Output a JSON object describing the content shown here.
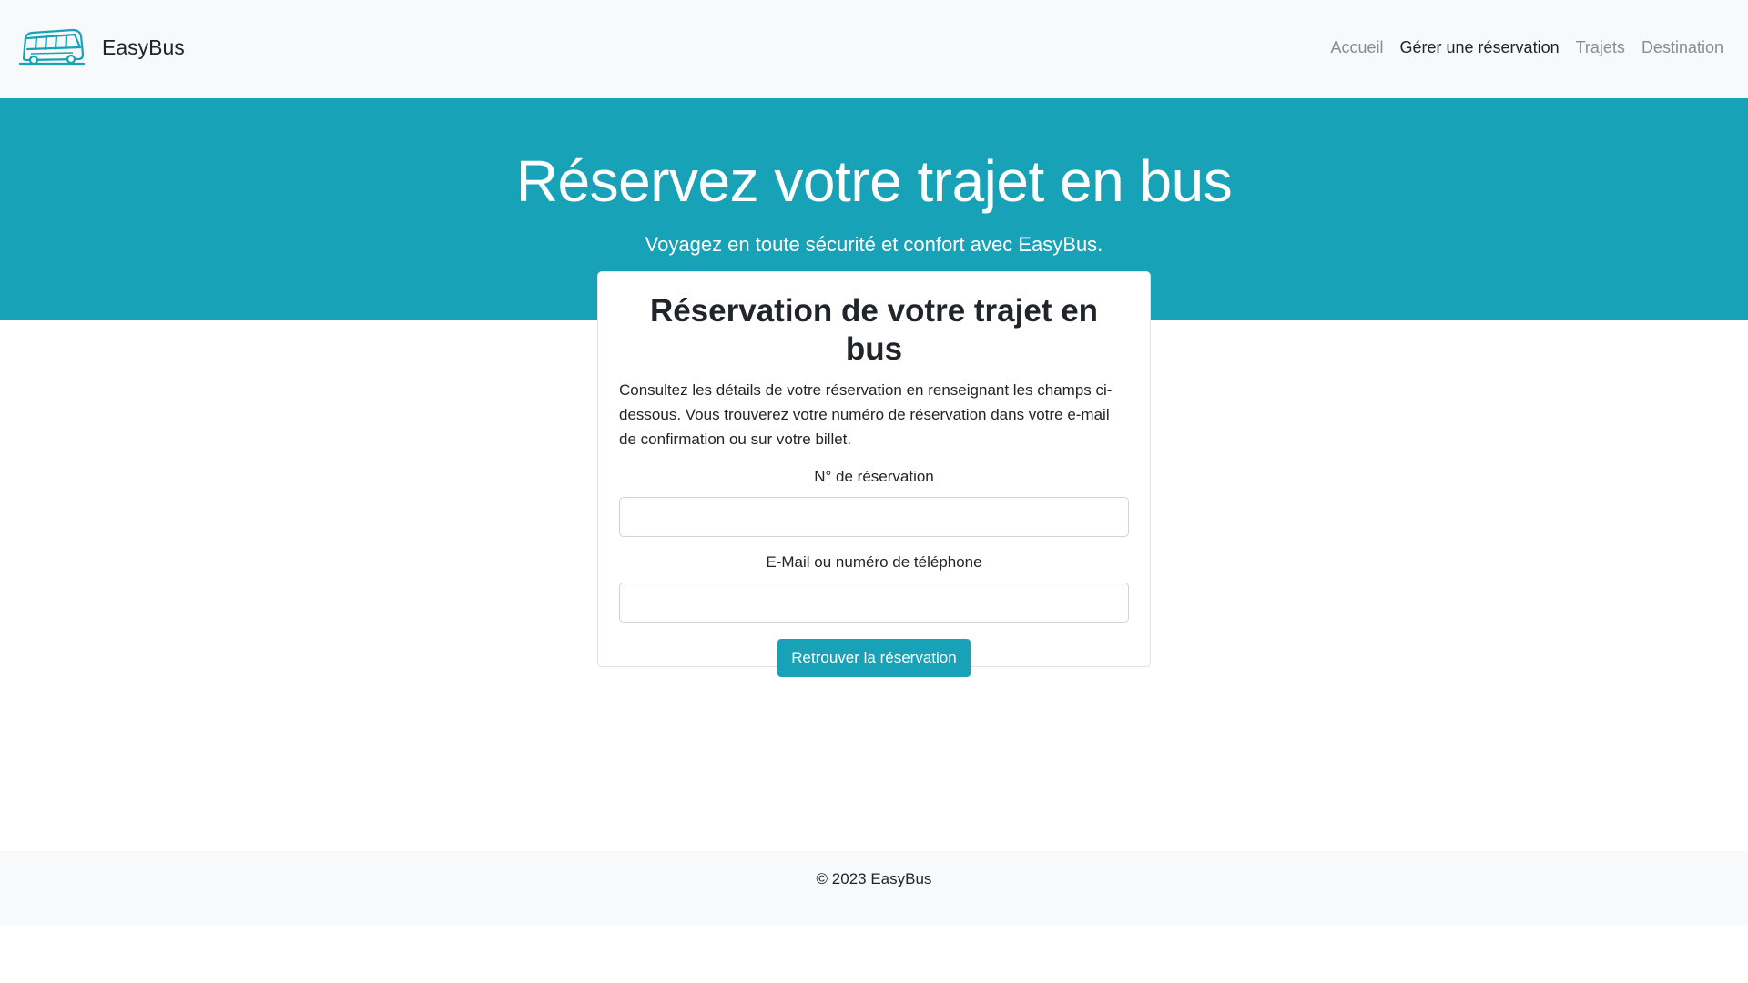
{
  "brand": {
    "name": "EasyBus",
    "logo_icon": "bus-icon",
    "accent_color": "#17a2b8"
  },
  "nav": {
    "items": [
      {
        "label": "Accueil",
        "active": false
      },
      {
        "label": "Gérer une réservation",
        "active": true
      },
      {
        "label": "Trajets",
        "active": false
      },
      {
        "label": "Destination",
        "active": false
      }
    ]
  },
  "hero": {
    "title": "Réservez votre trajet en bus",
    "subtitle": "Voyagez en toute sécurité et confort avec EasyBus."
  },
  "form": {
    "title": "Réservation de votre trajet en bus",
    "description": "Consultez les détails de votre réservation en renseignant les champs ci-dessous. Vous trouverez votre numéro de réservation dans votre e-mail de confirmation ou sur votre billet.",
    "reservation_label": "N° de réservation",
    "reservation_value": "",
    "contact_label": "E-Mail ou numéro de téléphone",
    "contact_value": "",
    "submit_label": "Retrouver la réservation"
  },
  "footer": {
    "copyright": "© 2023 EasyBus"
  }
}
